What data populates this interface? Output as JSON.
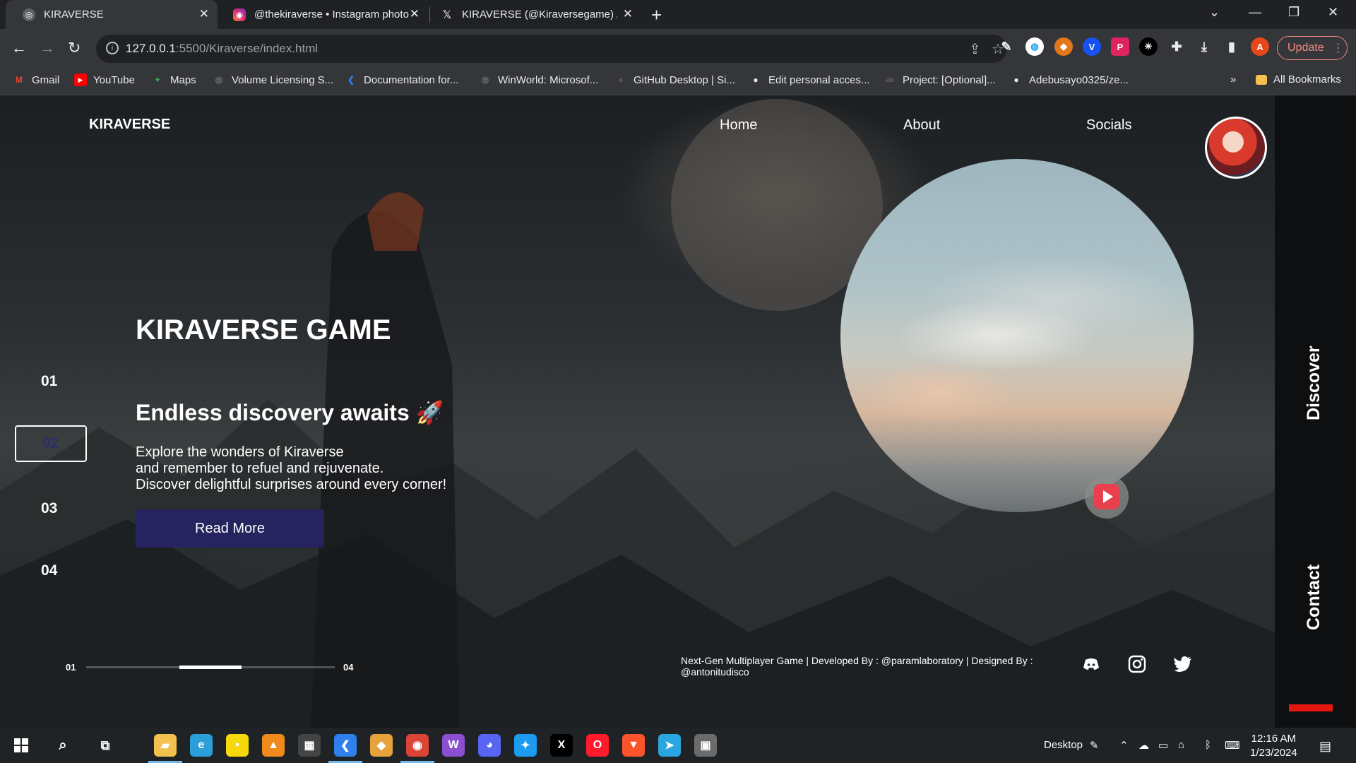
{
  "browser": {
    "tabs": [
      {
        "title": "KIRAVERSE",
        "icon": "globe-icon",
        "active": true
      },
      {
        "title": "@thekiraverse • Instagram photo",
        "icon": "instagram-icon",
        "active": false
      },
      {
        "title": "KIRAVERSE (@Kiraversegame) / X",
        "icon": "x-icon",
        "active": false
      }
    ],
    "new_tab": "+",
    "url_host": "127.0.0.1",
    "url_rest": ":5500/Kiraverse/index.html",
    "update_label": "Update",
    "profile_initial": "A",
    "bookmarks": [
      {
        "label": "Gmail",
        "icon": "gmail-icon",
        "color": "#ea4335"
      },
      {
        "label": "YouTube",
        "icon": "youtube-icon",
        "color": "#ff0000"
      },
      {
        "label": "Maps",
        "icon": "maps-icon",
        "color": "#34a853"
      },
      {
        "label": "Volume Licensing S...",
        "icon": "globe-icon",
        "color": "#9aa0a6"
      },
      {
        "label": "Documentation for...",
        "icon": "vscode-icon",
        "color": "#2f80ed"
      },
      {
        "label": "WinWorld: Microsof...",
        "icon": "globe-icon",
        "color": "#9aa0a6"
      },
      {
        "label": "GitHub Desktop | Si...",
        "icon": "github-icon",
        "color": "#555"
      },
      {
        "label": "Edit personal acces...",
        "icon": "github-icon",
        "color": "#e8eaed"
      },
      {
        "label": "Project: [Optional]...",
        "icon": "alx-icon",
        "color": "#777"
      },
      {
        "label": "Adebusayo0325/ze...",
        "icon": "github-icon",
        "color": "#e8eaed"
      }
    ],
    "bookmarks_overflow": "»",
    "all_bookmarks": "All Bookmarks"
  },
  "site": {
    "logo": "KIRAVERSE",
    "nav": [
      "Home",
      "About",
      "Socials"
    ],
    "hero": {
      "title": "KIRAVERSE GAME",
      "subtitle": "Endless discovery awaits 🚀",
      "lines": [
        "Explore the wonders of Kiraverse",
        "and remember to refuel and rejuvenate.",
        "Discover delightful surprises around every corner!"
      ],
      "cta": "Read More"
    },
    "slides": [
      "01",
      "02",
      "03",
      "04"
    ],
    "active_slide": "02",
    "progress": {
      "start": "01",
      "end": "04",
      "fraction": 0.5
    },
    "side": {
      "top": "Discover",
      "bottom": "Contact"
    },
    "footer": "Next-Gen Multiplayer Game | Developed By : @paramlaboratory | Designed By : @antonitudisco",
    "socials": [
      "discord-icon",
      "instagram-icon",
      "twitter-icon"
    ]
  },
  "taskbar": {
    "desktop_label": "Desktop",
    "time": "12:16 AM",
    "date": "1/23/2024",
    "apps": [
      {
        "name": "file-explorer-icon",
        "color": "#f2c14e"
      },
      {
        "name": "edge-icon",
        "color": "#2b9fd9"
      },
      {
        "name": "sticky-notes-icon",
        "color": "#f5d90a"
      },
      {
        "name": "vlc-icon",
        "color": "#f08a1c"
      },
      {
        "name": "calculator-icon",
        "color": "#444"
      },
      {
        "name": "vscode-icon",
        "color": "#2f80ed"
      },
      {
        "name": "git-icon",
        "color": "#e6a23c"
      },
      {
        "name": "chrome-icon",
        "color": "#db4437"
      },
      {
        "name": "app-icon",
        "color": "#8b4fd1"
      },
      {
        "name": "discord-icon",
        "color": "#5865f2"
      },
      {
        "name": "twitter-icon",
        "color": "#1d9bf0"
      },
      {
        "name": "x-icon",
        "color": "#000"
      },
      {
        "name": "opera-icon",
        "color": "#ff1b2d"
      },
      {
        "name": "brave-icon",
        "color": "#fb542b"
      },
      {
        "name": "telegram-icon",
        "color": "#2aa5e0"
      },
      {
        "name": "image-app-icon",
        "color": "#6b6b6b"
      }
    ]
  }
}
